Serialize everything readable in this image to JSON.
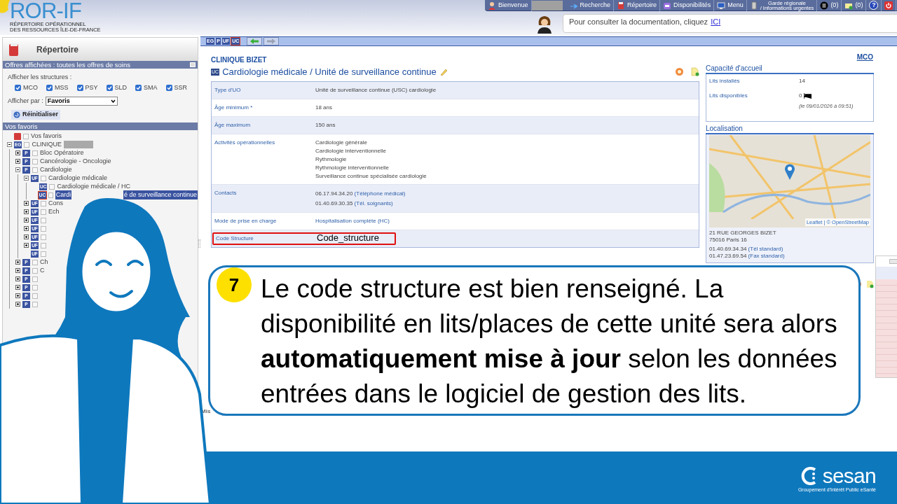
{
  "logo": {
    "title": "ROR-IF",
    "subtitle_1": "RÉPERTOIRE OPÉRATIONNEL",
    "subtitle_2": "DES RESSOURCES ÎLE-DE-FRANCE"
  },
  "topbar": [
    {
      "kind": "user",
      "label": "Bienvenue",
      "redacted": true
    },
    {
      "kind": "search",
      "label": "Recherche"
    },
    {
      "kind": "book",
      "label": "Répertoire"
    },
    {
      "kind": "calendar",
      "label": "Disponibilités"
    },
    {
      "kind": "monitor",
      "label": "Menu"
    },
    {
      "kind": "phone",
      "label": "Garde régionale",
      "label_2": "/ Informations urgentes"
    },
    {
      "kind": "list",
      "label": "(0)"
    },
    {
      "kind": "mail",
      "label": "(0)"
    },
    {
      "kind": "help",
      "label": "?"
    },
    {
      "kind": "power"
    }
  ],
  "doc_bubble": {
    "text": "Pour consulter la documentation, cliquez",
    "link": "ICI"
  },
  "sidebar": {
    "title": "Répertoire",
    "offers_bar": "Offres affichées : toutes les offres de soins",
    "structures_label": "Afficher les structures :",
    "structures": [
      {
        "label": "MCO",
        "checked": true
      },
      {
        "label": "MSS",
        "checked": true
      },
      {
        "label": "PSY",
        "checked": true
      },
      {
        "label": "SLD",
        "checked": true
      },
      {
        "label": "SMA",
        "checked": true
      },
      {
        "label": "SSR",
        "checked": true
      }
    ],
    "display_by_label": "Afficher par :",
    "display_by_value": "Favoris",
    "reset_button": "Réinitialiser",
    "favorites_bar": "Vos favoris",
    "tree": [
      {
        "label": "Vos favoris",
        "selected": false
      },
      {
        "badge": "EG",
        "label": "CLINIQUE",
        "redacted": true,
        "expanded": true,
        "selected": false,
        "children": [
          {
            "badge": "P",
            "label": "Bloc Opératoire",
            "expanded": false,
            "selected": false
          },
          {
            "badge": "P",
            "label": "Cancérologie - Oncologie",
            "expanded": false,
            "selected": false
          },
          {
            "badge": "P",
            "label": "Cardiologie",
            "expanded": true,
            "selected": false,
            "children": [
              {
                "badge": "UF",
                "label": "Cardiologie médicale",
                "expanded": true,
                "selected": false,
                "children": [
                  {
                    "badge": "UC",
                    "label": "Cardiologie médicale / HC",
                    "selected": false
                  },
                  {
                    "badge": "UC",
                    "label": "Cardi",
                    "label_end": "é de surveillance continue",
                    "selected": true
                  }
                ]
              },
              {
                "badge": "UF",
                "label": "Cons",
                "expanded": false,
                "selected": false
              },
              {
                "badge": "UF",
                "label": "Ech",
                "expanded": false,
                "selected": false
              },
              {
                "badge": "UF",
                "expanded": false,
                "selected": false
              },
              {
                "badge": "UF",
                "expanded": false,
                "selected": false
              },
              {
                "badge": "UF",
                "expanded": false,
                "selected": false
              },
              {
                "badge": "UF",
                "expanded": false,
                "selected": false
              },
              {
                "badge": "UF",
                "selected": false
              }
            ]
          },
          {
            "badge": "P",
            "label": "Ch",
            "expanded": false,
            "selected": false
          },
          {
            "badge": "P",
            "label": "C",
            "expanded": false,
            "selected": false
          },
          {
            "badge": "P",
            "expanded": false,
            "selected": false
          },
          {
            "badge": "P",
            "expanded": false,
            "selected": false
          },
          {
            "badge": "P",
            "expanded": false,
            "selected": false
          },
          {
            "badge": "P",
            "expanded": false,
            "selected": false
          }
        ]
      }
    ]
  },
  "nav_badges": [
    {
      "label": "EG",
      "selected": false
    },
    {
      "label": "P",
      "selected": false
    },
    {
      "label": "UF",
      "selected": false
    },
    {
      "label": "UC",
      "selected": true
    }
  ],
  "nav_arrows": [
    {
      "kind": "back",
      "disabled": false
    },
    {
      "kind": "forward",
      "disabled": true
    }
  ],
  "unit": {
    "establishment": "CLINIQUE BIZET",
    "badge": "UC",
    "title": "Cardiologie médicale / Unité de surveillance continue",
    "domain_link": "MCO"
  },
  "details": [
    {
      "label": "Type d'UO",
      "highlighted": false,
      "values": [
        {
          "kind": "plain",
          "text": "Unité de surveillance continue (USC) cardiologie"
        }
      ]
    },
    {
      "label": "Âge minimum *",
      "highlighted": false,
      "values": [
        {
          "kind": "plain",
          "text": "18 ans"
        }
      ]
    },
    {
      "label": "Âge maximum",
      "highlighted": false,
      "values": [
        {
          "kind": "plain",
          "text": "150 ans"
        }
      ]
    },
    {
      "label": "Activités opérationnelles",
      "highlighted": false,
      "values": [
        {
          "kind": "plain",
          "text": "Cardiologie générale"
        },
        {
          "kind": "plain",
          "text": "Cardiologie interventionnelle"
        },
        {
          "kind": "plain",
          "text": "Rythmologie"
        },
        {
          "kind": "plain",
          "text": "Rythmologie interventionnelle"
        },
        {
          "kind": "plain",
          "text": "Surveillance continue spécialisée cardiologie"
        }
      ]
    },
    {
      "label": "Contacts",
      "highlighted": false,
      "values": [
        {
          "kind": "phone",
          "text": "06.17.94.34.20",
          "note": "(Téléphone médical)"
        },
        {
          "kind": "phone",
          "text": "01.40.69.30.35",
          "note": "(Tél. soignants)"
        }
      ]
    },
    {
      "label": "Mode de prise en charge",
      "highlighted": false,
      "values": [
        {
          "kind": "link",
          "text": "Hospitalisation complète (HC)"
        }
      ]
    },
    {
      "label": "Code Structure",
      "highlighted": true,
      "values": [
        {
          "kind": "large",
          "text": "Code_structure"
        }
      ]
    }
  ],
  "capacity": {
    "title": "Capacité d'accueil",
    "rows": [
      {
        "label": "Lits installés",
        "value": "14"
      },
      {
        "label": "Lits disponibles",
        "value": "0",
        "kind": "beds",
        "note": "(le 09/01/2026 à 09:51)"
      }
    ]
  },
  "location": {
    "title": "Localisation",
    "attribution_1": "Leaflet",
    "attribution_2": "| © OpenStreetMap",
    "address": [
      "21 RUE GEORGES BIZET",
      "75016 Paris 16"
    ],
    "phones": [
      {
        "number": "01.40.69.34.34",
        "note": "(Tél standard)"
      },
      {
        "number": "01.47.23.69.54",
        "note": "(Fax standard)"
      }
    ]
  },
  "lower_panel": {
    "label": "Mis"
  },
  "callout": {
    "step": "7",
    "text": "Le code structure est bien renseigné. La disponibilité en lits/places de cette unité sera alors **automatiquement mise à jour** selon les données entrées dans le logiciel de gestion des lits."
  },
  "brand": {
    "name": "sesan",
    "tagline": "Groupement d'Intérêt Public eSanté"
  }
}
